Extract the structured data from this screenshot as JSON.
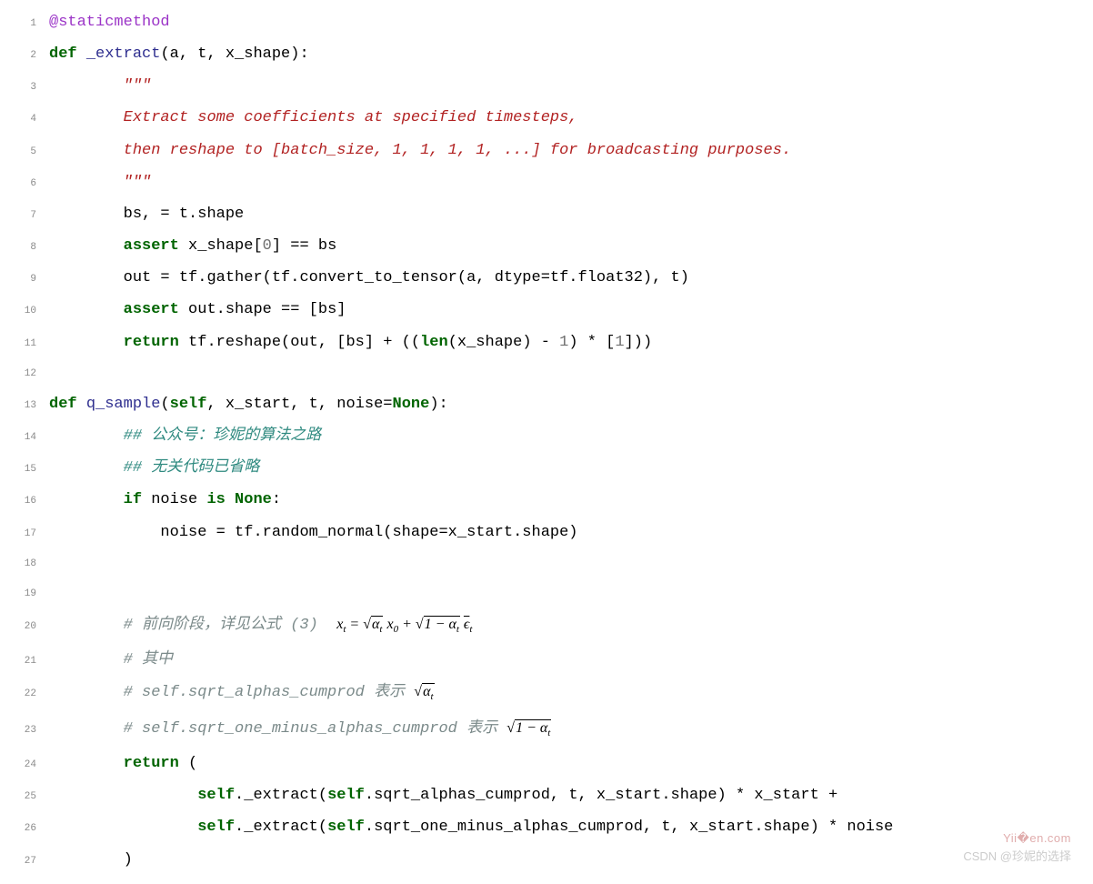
{
  "lines": [
    {
      "num": "1",
      "indent": 0,
      "tokens": [
        {
          "cls": "tok-dec",
          "t": "@staticmethod"
        }
      ]
    },
    {
      "num": "2",
      "indent": 0,
      "tokens": [
        {
          "cls": "tok-kw",
          "t": "def "
        },
        {
          "cls": "tok-fn",
          "t": "_extract"
        },
        {
          "cls": "tok-plain",
          "t": "(a, t, x_shape):"
        }
      ]
    },
    {
      "num": "3",
      "indent": 2,
      "tokens": [
        {
          "cls": "tok-doc",
          "t": "\"\"\""
        }
      ]
    },
    {
      "num": "4",
      "indent": 2,
      "tokens": [
        {
          "cls": "tok-doc",
          "t": "Extract some coefficients at specified timesteps,"
        }
      ]
    },
    {
      "num": "5",
      "indent": 2,
      "tokens": [
        {
          "cls": "tok-doc",
          "t": "then reshape to [batch_size, 1, 1, 1, 1, ...] for broadcasting purposes."
        }
      ]
    },
    {
      "num": "6",
      "indent": 2,
      "tokens": [
        {
          "cls": "tok-doc",
          "t": "\"\"\""
        }
      ]
    },
    {
      "num": "7",
      "indent": 2,
      "tokens": [
        {
          "cls": "tok-plain",
          "t": "bs, = t.shape"
        }
      ]
    },
    {
      "num": "8",
      "indent": 2,
      "tokens": [
        {
          "cls": "tok-kw",
          "t": "assert"
        },
        {
          "cls": "tok-plain",
          "t": " x_shape["
        },
        {
          "cls": "tok-num",
          "t": "0"
        },
        {
          "cls": "tok-plain",
          "t": "] == bs"
        }
      ]
    },
    {
      "num": "9",
      "indent": 2,
      "tokens": [
        {
          "cls": "tok-plain",
          "t": "out = tf.gather(tf.convert_to_tensor(a, dtype=tf.float32), t)"
        }
      ]
    },
    {
      "num": "10",
      "indent": 2,
      "tokens": [
        {
          "cls": "tok-kw",
          "t": "assert"
        },
        {
          "cls": "tok-plain",
          "t": " out.shape == [bs]"
        }
      ]
    },
    {
      "num": "11",
      "indent": 2,
      "tokens": [
        {
          "cls": "tok-kw",
          "t": "return"
        },
        {
          "cls": "tok-plain",
          "t": " tf.reshape(out, [bs] + (("
        },
        {
          "cls": "tok-kw",
          "t": "len"
        },
        {
          "cls": "tok-plain",
          "t": "(x_shape) - "
        },
        {
          "cls": "tok-num",
          "t": "1"
        },
        {
          "cls": "tok-plain",
          "t": ") * ["
        },
        {
          "cls": "tok-num",
          "t": "1"
        },
        {
          "cls": "tok-plain",
          "t": "]))"
        }
      ]
    },
    {
      "num": "12",
      "indent": 0,
      "tokens": []
    },
    {
      "num": "13",
      "indent": 0,
      "tokens": [
        {
          "cls": "tok-kw",
          "t": "def "
        },
        {
          "cls": "tok-fn",
          "t": "q_sample"
        },
        {
          "cls": "tok-plain",
          "t": "("
        },
        {
          "cls": "tok-kw",
          "t": "self"
        },
        {
          "cls": "tok-plain",
          "t": ", x_start, t, noise="
        },
        {
          "cls": "tok-kw",
          "t": "None"
        },
        {
          "cls": "tok-plain",
          "t": "):"
        }
      ]
    },
    {
      "num": "14",
      "indent": 2,
      "tokens": [
        {
          "cls": "tok-cmtcn",
          "t": "## 公众号：珍妮的算法之路"
        }
      ]
    },
    {
      "num": "15",
      "indent": 2,
      "tokens": [
        {
          "cls": "tok-cmtcn",
          "t": "## 无关代码已省略"
        }
      ]
    },
    {
      "num": "16",
      "indent": 2,
      "tokens": [
        {
          "cls": "tok-kw",
          "t": "if"
        },
        {
          "cls": "tok-plain",
          "t": " noise "
        },
        {
          "cls": "tok-kw",
          "t": "is None"
        },
        {
          "cls": "tok-plain",
          "t": ":"
        }
      ]
    },
    {
      "num": "17",
      "indent": 3,
      "tokens": [
        {
          "cls": "tok-plain",
          "t": "noise = tf.random_normal(shape=x_start.shape)"
        }
      ]
    },
    {
      "num": "18",
      "indent": 0,
      "tokens": []
    },
    {
      "num": "19",
      "indent": 0,
      "tokens": []
    },
    {
      "num": "20",
      "indent": 2,
      "tokens": [
        {
          "cls": "tok-cmt2",
          "t": "# 前向阶段，详见公式 (3)  "
        },
        {
          "cls": "math",
          "html": "x<sub>t</sub> = √<span class='radicand'><span class='bar'>α</span><sub>t</sub></span> x<sub>0</sub> + √<span class='radicand'>1 − <span class='bar'>α</span><sub>t</sub></span> <span class='bar'>ϵ</span><sub>t</sub>"
        }
      ]
    },
    {
      "num": "21",
      "indent": 2,
      "tokens": [
        {
          "cls": "tok-cmt2",
          "t": "# 其中"
        }
      ]
    },
    {
      "num": "22",
      "indent": 2,
      "tokens": [
        {
          "cls": "tok-cmt2",
          "t": "# self.sqrt_alphas_cumprod 表示 "
        },
        {
          "cls": "math",
          "html": "√<span class='radicand'><span class='bar'>α</span><sub>t</sub></span>"
        }
      ]
    },
    {
      "num": "23",
      "indent": 2,
      "tokens": [
        {
          "cls": "tok-cmt2",
          "t": "# self.sqrt_one_minus_alphas_cumprod 表示 "
        },
        {
          "cls": "math",
          "html": "√<span class='radicand'>1 − <span class='bar'>α</span><sub>t</sub></span>"
        }
      ]
    },
    {
      "num": "24",
      "indent": 2,
      "tokens": [
        {
          "cls": "tok-kw",
          "t": "return"
        },
        {
          "cls": "tok-plain",
          "t": " ("
        }
      ]
    },
    {
      "num": "25",
      "indent": 4,
      "tokens": [
        {
          "cls": "tok-kw",
          "t": "self"
        },
        {
          "cls": "tok-plain",
          "t": "._extract("
        },
        {
          "cls": "tok-kw",
          "t": "self"
        },
        {
          "cls": "tok-plain",
          "t": ".sqrt_alphas_cumprod, t, x_start.shape) * x_start +"
        }
      ]
    },
    {
      "num": "26",
      "indent": 4,
      "tokens": [
        {
          "cls": "tok-kw",
          "t": "self"
        },
        {
          "cls": "tok-plain",
          "t": "._extract("
        },
        {
          "cls": "tok-kw",
          "t": "self"
        },
        {
          "cls": "tok-plain",
          "t": ".sqrt_one_minus_alphas_cumprod, t, x_start.shape) * noise"
        }
      ]
    },
    {
      "num": "27",
      "indent": 2,
      "tokens": [
        {
          "cls": "tok-plain",
          "t": ")"
        }
      ]
    }
  ],
  "watermarks": {
    "wm1": "Yii�en.com",
    "wm2": "CSDN @珍妮的选择"
  }
}
